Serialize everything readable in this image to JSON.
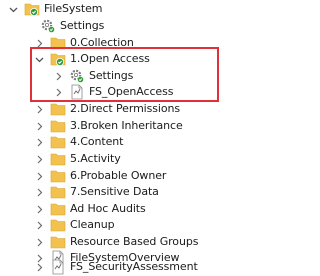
{
  "root": {
    "label": "FileSystem",
    "expanded": true
  },
  "items": [
    {
      "label": "Settings",
      "icon": "gear-icon",
      "expander": "none"
    },
    {
      "label": "0.Collection",
      "icon": "folder-icon",
      "expander": "collapsed"
    },
    {
      "label": "1.Open Access",
      "icon": "folder-icon",
      "expander": "expanded",
      "selected": true
    },
    {
      "label": "Settings",
      "icon": "gear-icon",
      "expander": "collapsed",
      "child": true
    },
    {
      "label": "FS_OpenAccess",
      "icon": "report-icon",
      "expander": "collapsed",
      "child": true
    },
    {
      "label": "2.Direct Permissions",
      "icon": "folder-icon",
      "expander": "collapsed"
    },
    {
      "label": "3.Broken Inheritance",
      "icon": "folder-icon",
      "expander": "collapsed"
    },
    {
      "label": "4.Content",
      "icon": "folder-icon",
      "expander": "collapsed"
    },
    {
      "label": "5.Activity",
      "icon": "folder-icon",
      "expander": "collapsed"
    },
    {
      "label": "6.Probable Owner",
      "icon": "folder-icon",
      "expander": "collapsed"
    },
    {
      "label": "7.Sensitive Data",
      "icon": "folder-icon",
      "expander": "collapsed"
    },
    {
      "label": "Ad Hoc Audits",
      "icon": "folder-icon",
      "expander": "collapsed"
    },
    {
      "label": "Cleanup",
      "icon": "folder-icon",
      "expander": "collapsed"
    },
    {
      "label": "Resource Based Groups",
      "icon": "folder-icon",
      "expander": "collapsed"
    },
    {
      "label": "FileSystemOverview",
      "icon": "report-icon",
      "expander": "collapsed"
    },
    {
      "label": "FS_SecurityAssessment",
      "icon": "report-icon",
      "expander": "collapsed"
    }
  ],
  "colors": {
    "folder": "#f2c14e",
    "check": "#2e9e3a",
    "highlight": "#e0303a",
    "chevron": "#6b6b6b"
  }
}
